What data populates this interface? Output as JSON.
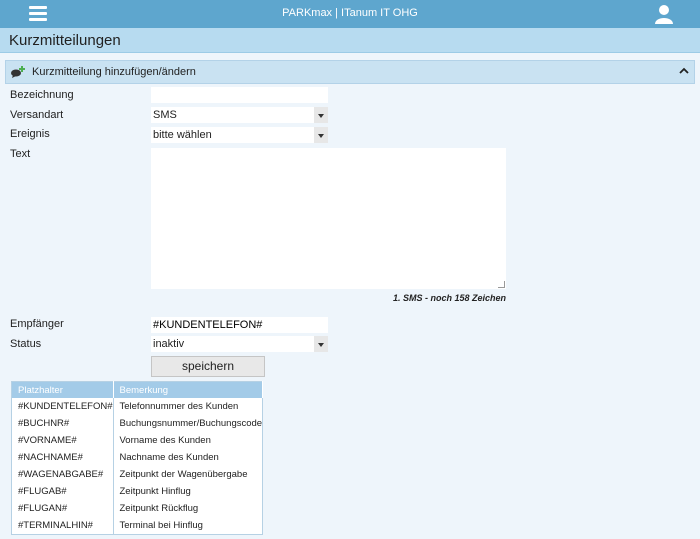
{
  "header": {
    "app_title": "PARKmax | ITanum IT OHG"
  },
  "page": {
    "title": "Kurzmitteilungen"
  },
  "section": {
    "label": "Kurzmitteilung hinzufügen/ändern"
  },
  "form": {
    "bezeichnung": {
      "label": "Bezeichnung",
      "value": ""
    },
    "versandart": {
      "label": "Versandart",
      "value": "SMS"
    },
    "ereignis": {
      "label": "Ereignis",
      "value": "bitte wählen"
    },
    "text": {
      "label": "Text",
      "value": ""
    },
    "counter": "1. SMS - noch 158 Zeichen",
    "empfaenger": {
      "label": "Empfänger",
      "value": "#KUNDENTELEFON#"
    },
    "status": {
      "label": "Status",
      "value": "inaktiv"
    },
    "save_label": "speichern"
  },
  "placeholders": {
    "headers": [
      "Platzhalter",
      "Bemerkung"
    ],
    "rows": [
      [
        "#KUNDENTELEFON#",
        "Telefonnummer des Kunden"
      ],
      [
        "#BUCHNR#",
        "Buchungsnummer/Buchungscode"
      ],
      [
        "#VORNAME#",
        "Vorname des Kunden"
      ],
      [
        "#NACHNAME#",
        "Nachname des Kunden"
      ],
      [
        "#WAGENABGABE#",
        "Zeitpunkt der Wagenübergabe"
      ],
      [
        "#FLUGAB#",
        "Zeitpunkt Hinflug"
      ],
      [
        "#FLUGAN#",
        "Zeitpunkt Rückflug"
      ],
      [
        "#TERMINALHIN#",
        "Terminal bei Hinflug"
      ]
    ]
  },
  "colors": {
    "topbar": "#5ea6ce",
    "titlebar": "#b7dbf0",
    "section": "#c9e2f2",
    "table_header": "#a3cbe8",
    "background": "#eef5fb",
    "icon_accent": "#4caf50"
  },
  "icons": {
    "menu": "hamburger-menu-icon",
    "user": "user-icon",
    "section": "chat-add-icon",
    "collapse": "chevron-up-icon"
  }
}
